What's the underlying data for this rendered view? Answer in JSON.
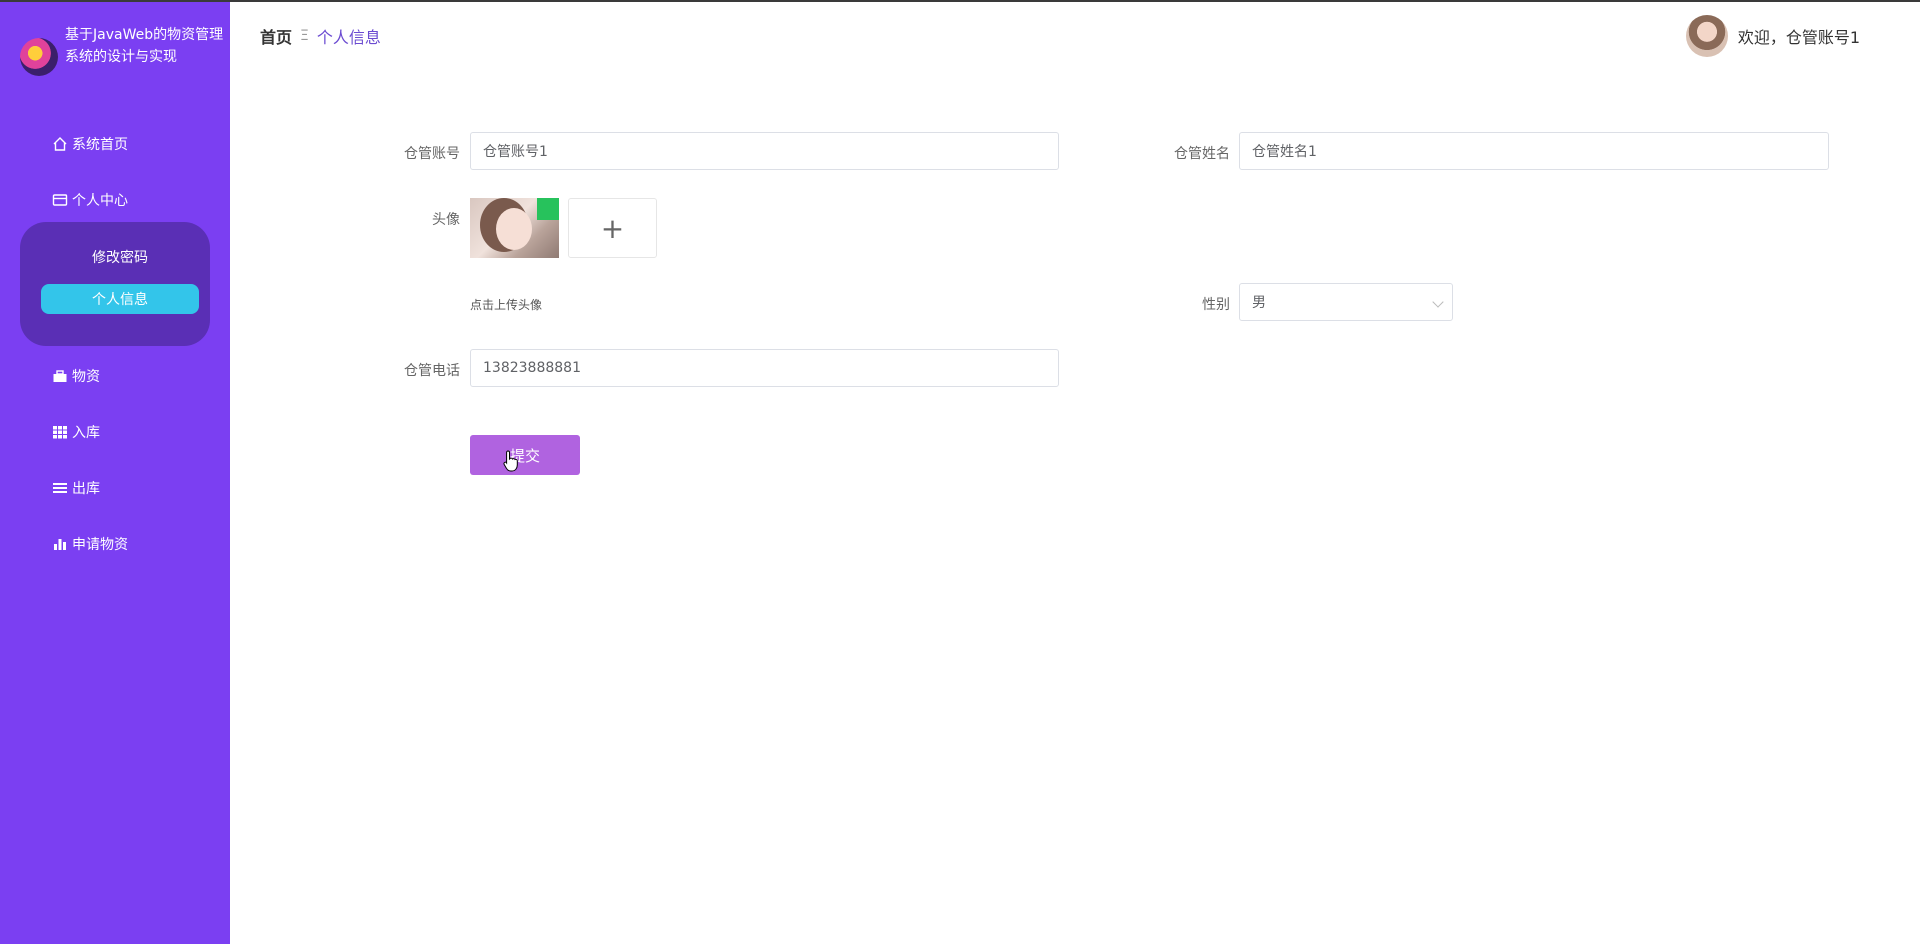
{
  "app": {
    "title": "基于JavaWeb的物资管理系统的设计与实现"
  },
  "sidebar": {
    "items": [
      {
        "label": "系统首页",
        "icon": "home-icon"
      },
      {
        "label": "个人中心",
        "icon": "card-icon"
      },
      {
        "label": "物资",
        "icon": "briefcase-icon"
      },
      {
        "label": "入库",
        "icon": "grid-icon"
      },
      {
        "label": "出库",
        "icon": "list-icon"
      },
      {
        "label": "申请物资",
        "icon": "bar-chart-icon"
      }
    ],
    "submenu": [
      {
        "label": "修改密码"
      },
      {
        "label": "个人信息",
        "active": true
      }
    ]
  },
  "header": {
    "breadcrumb_home": "首页",
    "breadcrumb_sep": "Ξ",
    "breadcrumb_current": "个人信息",
    "welcome": "欢迎，仓管账号1"
  },
  "form": {
    "account_label": "仓管账号",
    "account_value": "仓管账号1",
    "name_label": "仓管姓名",
    "name_value": "仓管姓名1",
    "avatar_label": "头像",
    "upload_plus": "+",
    "upload_hint": "点击上传头像",
    "gender_label": "性别",
    "gender_value": "男",
    "phone_label": "仓管电话",
    "phone_value": "13823888881",
    "submit_label": "提交"
  },
  "colors": {
    "sidebar_bg": "#7b3ff2",
    "submenu_bg": "#5a2fb5",
    "active_item": "#33c5ea",
    "breadcrumb_current": "#6b4bd1",
    "submit_bg": "#b063e0"
  }
}
